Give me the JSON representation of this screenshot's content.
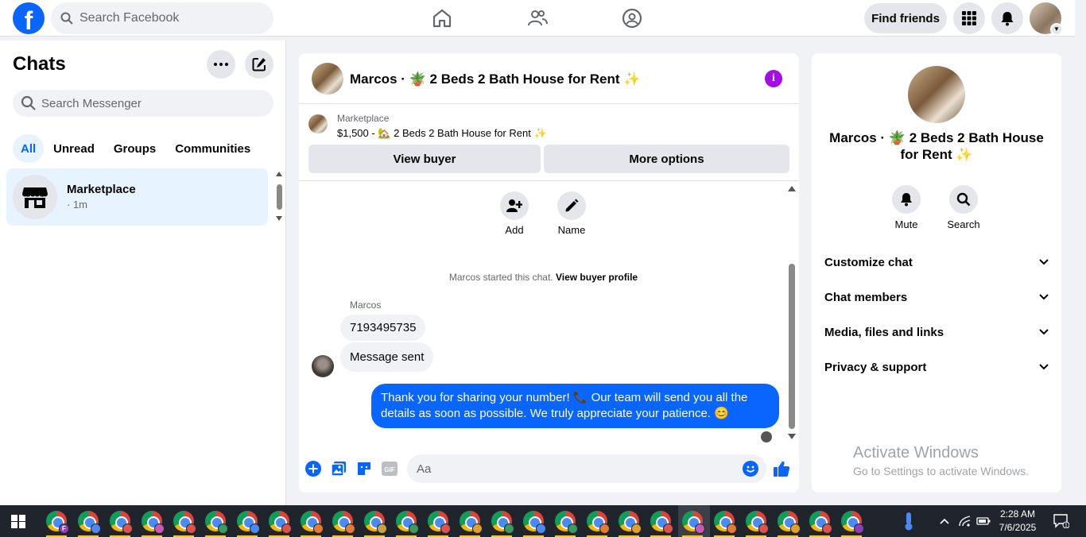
{
  "header": {
    "logo": "f",
    "search_placeholder": "Search Facebook",
    "find_friends": "Find friends"
  },
  "sidebar": {
    "title": "Chats",
    "search_placeholder": "Search Messenger",
    "filters": [
      "All",
      "Unread",
      "Groups",
      "Communities"
    ],
    "active_filter": "All",
    "chats": [
      {
        "name": "Marketplace",
        "time": "· 1m"
      }
    ]
  },
  "conversation": {
    "title": "Marcos · 🪴 2 Beds 2 Bath House for Rent ✨",
    "listing": {
      "label": "Marketplace",
      "price_line": "$1,500 - 🏡 2 Beds 2 Bath House for Rent ✨",
      "view_buyer": "View buyer",
      "more_options": "More options"
    },
    "actions": [
      {
        "label": "Add",
        "icon": "add-person-icon"
      },
      {
        "label": "Name",
        "icon": "pencil-icon"
      }
    ],
    "started_text": "Marcos started this chat.",
    "started_link": "View buyer profile",
    "sender_name": "Marcos",
    "incoming": [
      "7193495735",
      "Message sent"
    ],
    "outgoing": "Thank you for sharing your number! 📞 Our team will send you all the details as soon as possible. We truly appreciate your patience. 😊",
    "composer_placeholder": "Aa",
    "gif_label": "GIF"
  },
  "details": {
    "title": "Marcos · 🪴 2 Beds 2 Bath House for Rent ✨",
    "actions": [
      {
        "label": "Mute",
        "icon": "bell-icon"
      },
      {
        "label": "Search",
        "icon": "search-icon"
      }
    ],
    "sections": [
      "Customize chat",
      "Chat members",
      "Media, files and links",
      "Privacy & support"
    ]
  },
  "watermark": {
    "line1": "Activate Windows",
    "line2": "Go to Settings to activate Windows."
  },
  "taskbar": {
    "time": "2:28 AM",
    "date": "7/6/2025",
    "notification_count": "1",
    "profile_badge_letter": "F"
  },
  "colors": {
    "brand": "#0866ff",
    "outgoing_bubble": "#0866ff",
    "info_icon": "#a40ee5",
    "selected_bg": "#e7f3ff"
  }
}
